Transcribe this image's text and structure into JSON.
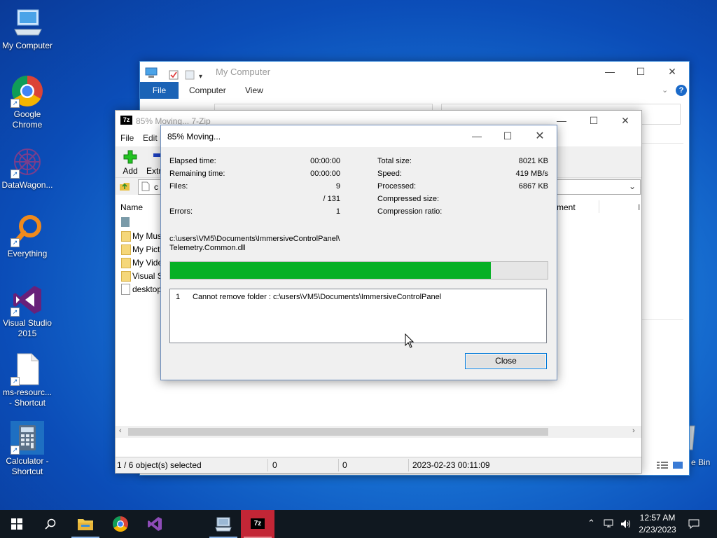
{
  "desktop": {
    "icons": [
      {
        "label": "My Computer"
      },
      {
        "label": "Google Chrome"
      },
      {
        "label": "DataWagon..."
      },
      {
        "label": "Everything"
      },
      {
        "label": "Visual Studio 2015"
      },
      {
        "label": "ms-resourc... - Shortcut"
      },
      {
        "label": "Calculator - Shortcut"
      }
    ],
    "recycle_bin_label": "e Bin"
  },
  "explorer": {
    "title": "My Computer",
    "tabs": {
      "file": "File",
      "computer": "Computer",
      "view": "View"
    }
  },
  "zip": {
    "title": "85% Moving... 7-Zip",
    "menu": {
      "file": "File",
      "edit": "Edit"
    },
    "toolbar": {
      "add": "Add",
      "extract": "Extr"
    },
    "address_fragment": "c",
    "list": {
      "col_name": "Name",
      "col_comment": "ment",
      "col_extra": "I",
      "rows": [
        {
          "name": ""
        },
        {
          "name": "My Mus"
        },
        {
          "name": "My Pict"
        },
        {
          "name": "My Vide"
        },
        {
          "name": "Visual St"
        },
        {
          "name": "desktop"
        }
      ]
    },
    "status": {
      "selected": "1 / 6 object(s) selected",
      "size1": "0",
      "size2": "0",
      "modified": "2023-02-23 00:11:09"
    }
  },
  "dialog": {
    "title": "85% Moving...",
    "left": {
      "elapsed_label": "Elapsed time:",
      "elapsed_value": "00:00:00",
      "remaining_label": "Remaining time:",
      "remaining_value": "00:00:00",
      "files_label": "Files:",
      "files_value": "9",
      "files_total": "/ 131",
      "errors_label": "Errors:",
      "errors_value": "1"
    },
    "right": {
      "total_label": "Total size:",
      "total_value": "8021 KB",
      "speed_label": "Speed:",
      "speed_value": "419 MB/s",
      "processed_label": "Processed:",
      "processed_value": "6867 KB",
      "compressed_label": "Compressed size:",
      "ratio_label": "Compression ratio:"
    },
    "path_line1": "c:\\users\\VM5\\Documents\\ImmersiveControlPanel\\",
    "path_line2": "Telemetry.Common.dll",
    "progress_percent": 85,
    "errors": [
      {
        "index": "1",
        "message": "Cannot remove folder : c:\\users\\VM5\\Documents\\ImmersiveControlPanel"
      }
    ],
    "close_label": "Close"
  },
  "taskbar": {
    "time": "12:57 AM",
    "date": "2/23/2023"
  },
  "colors": {
    "progress_fill": "#06b025",
    "explorer_file_tab": "#1b63b6",
    "zip_taskbar_active": "#c32636"
  }
}
